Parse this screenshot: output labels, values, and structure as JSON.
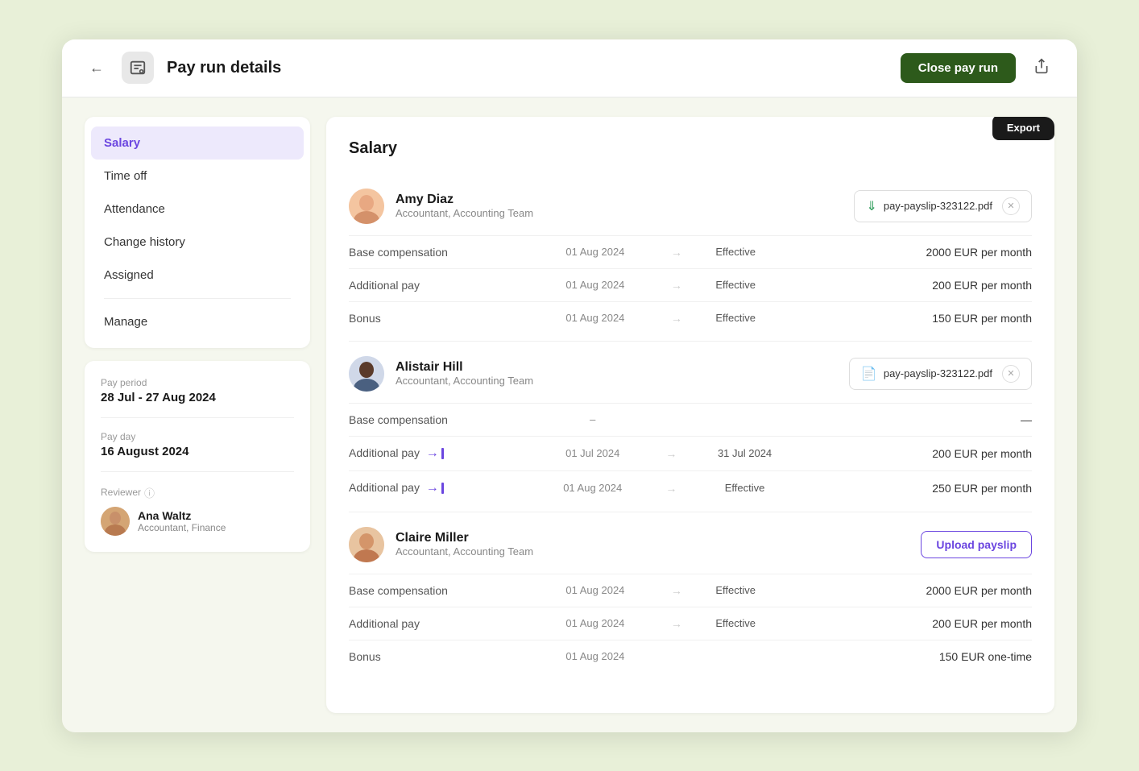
{
  "app": {
    "title": "Pay run details",
    "close_btn": "Close pay run",
    "export_label": "Export"
  },
  "nav": {
    "items": [
      {
        "id": "salary",
        "label": "Salary",
        "active": true
      },
      {
        "id": "time-off",
        "label": "Time off",
        "active": false
      },
      {
        "id": "attendance",
        "label": "Attendance",
        "active": false
      },
      {
        "id": "change-history",
        "label": "Change history",
        "active": false
      },
      {
        "id": "assigned",
        "label": "Assigned",
        "active": false
      },
      {
        "id": "manage",
        "label": "Manage",
        "active": false
      }
    ]
  },
  "payperiod": {
    "label": "Pay period",
    "value": "28 Jul - 27 Aug 2024",
    "payday_label": "Pay day",
    "payday_value": "16 August 2024"
  },
  "reviewer": {
    "label": "Reviewer",
    "name": "Ana Waltz",
    "role": "Accountant, Finance"
  },
  "main": {
    "section_title": "Salary",
    "employees": [
      {
        "id": "amy",
        "name": "Amy Diaz",
        "role": "Accountant, Accounting Team",
        "payslip": {
          "filename": "pay-payslip-323122.pdf",
          "type": "download"
        },
        "rows": [
          {
            "label": "Base compensation",
            "date_from": "01 Aug 2024",
            "date_to": "Effective",
            "amount": "2000 EUR per month"
          },
          {
            "label": "Additional pay",
            "date_from": "01 Aug 2024",
            "date_to": "Effective",
            "amount": "200 EUR per month"
          },
          {
            "label": "Bonus",
            "date_from": "01 Aug 2024",
            "date_to": "Effective",
            "amount": "150 EUR per month"
          }
        ]
      },
      {
        "id": "alistair",
        "name": "Alistair Hill",
        "role": "Accountant, Accounting Team",
        "payslip": {
          "filename": "pay-payslip-323122.pdf",
          "type": "doc"
        },
        "rows": [
          {
            "label": "Base compensation",
            "date_from": "–",
            "date_to": "",
            "amount": "—",
            "no_dates": true
          },
          {
            "label": "Additional pay",
            "date_from": "01 Jul 2024",
            "date_to": "31 Jul 2024",
            "amount": "200 EUR per month",
            "has_history": true
          },
          {
            "label": "Additional pay",
            "date_from": "01 Aug 2024",
            "date_to": "Effective",
            "amount": "250 EUR per month",
            "has_history": true
          }
        ]
      },
      {
        "id": "claire",
        "name": "Claire Miller",
        "role": "Accountant, Accounting Team",
        "payslip": null,
        "upload_label": "Upload payslip",
        "rows": [
          {
            "label": "Base compensation",
            "date_from": "01 Aug 2024",
            "date_to": "Effective",
            "amount": "2000 EUR per month"
          },
          {
            "label": "Additional pay",
            "date_from": "01 Aug 2024",
            "date_to": "Effective",
            "amount": "200 EUR per month"
          },
          {
            "label": "Bonus",
            "date_from": "01 Aug 2024",
            "date_to": "",
            "amount": "150 EUR one-time",
            "no_arrow": true
          }
        ]
      }
    ]
  }
}
